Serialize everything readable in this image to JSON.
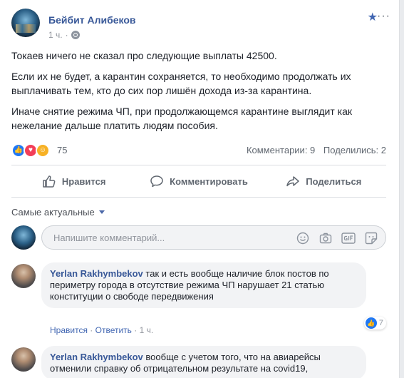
{
  "post": {
    "author": "Бейбит Алибеков",
    "time": "1 ч.",
    "paragraphs": [
      "Токаев ничего не сказал про следующие выплаты 42500.",
      "Если их не будет, а карантин сохраняется, то необходимо продолжать их выплачивать тем, кто до сих пор лишён дохода из-за карантина.",
      "Иначе снятие режима ЧП, при продолжающемся карантине выглядит как нежелание дальше платить людям пособия."
    ],
    "reactions_count": "75",
    "comments_count_label": "Комментарии: 9",
    "shares_label": "Поделились: 2"
  },
  "actions": {
    "like": "Нравится",
    "comment": "Комментировать",
    "share": "Поделиться"
  },
  "sort_label": "Самые актуальные",
  "composer": {
    "placeholder": "Напишите комментарий..."
  },
  "comments": [
    {
      "name": "Yerlan Rakhymbekov",
      "text": "так и есть вообще наличие блок постов по периметру города в отсутствие режима ЧП нарушает 21 статью конституции о свободе передвижения",
      "like": "Нравится",
      "reply": "Ответить",
      "time": "1 ч.",
      "likes": "7"
    },
    {
      "name": "Yerlan Rakhymbekov",
      "text": "вообще с учетом того, что на авиарейсы отменили справку об отрицательном результате на covid19,"
    }
  ],
  "colors": {
    "accent": "#385898",
    "like_blue": "#2078f4",
    "love_red": "#f33e58",
    "care_yellow": "#f7b125"
  },
  "icons": {
    "like": "thumbs-up-icon",
    "comment": "speech-bubble-icon",
    "share": "share-arrow-icon",
    "favorite": "star-icon",
    "privacy": "globe-icon"
  }
}
